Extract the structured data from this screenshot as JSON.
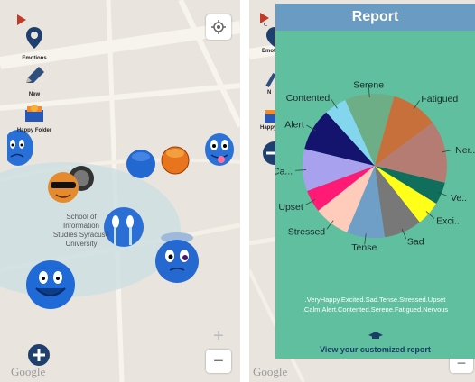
{
  "left_screen": {
    "toolbar": {
      "emotions_label": "Emotions",
      "new_label": "New",
      "happy_folder_label": "Happy Folder"
    },
    "place_label": "School of Information Studies Syracuse University",
    "place_lines": [
      "School of",
      "Information",
      "Studies Syracuse",
      "University"
    ],
    "zoom_in_label": "+",
    "zoom_out_label": "−",
    "google_label": "Google"
  },
  "right_screen": {
    "behind": {
      "emotions_label": "Emoti",
      "new_label": "N",
      "happy_label": "Happy",
      "google_label": "Google",
      "top_label": "L"
    },
    "report": {
      "title": "Report",
      "legend_line1": ".VeryHappy.Excited.Sad.Tense.Stressed.Upset",
      "legend_line2": ".Calm.Alert.Contented.Serene.Fatigued.Nervous",
      "view_report_label": "View your customized report"
    }
  },
  "colors": {
    "report_header": "#6a9bc3",
    "report_panel": "#5fbf9f",
    "map_background": "#e9e5de",
    "campus_area": "#cfdfe2"
  },
  "chart_data": {
    "type": "pie",
    "title": "",
    "categories": [
      "Fatigued",
      "Ner..",
      "Ve..",
      "Exci..",
      "Sad",
      "Tense",
      "Stressed",
      "Upset",
      "Ca...",
      "Alert",
      "Contented",
      "Serene"
    ],
    "full_names": [
      "Fatigued",
      "Nervous",
      "VeryHappy",
      "Excited",
      "Sad",
      "Tense",
      "Stressed",
      "Upset",
      "Calm",
      "Alert",
      "Contented",
      "Serene"
    ],
    "values": [
      10.5,
      14.0,
      5.0,
      5.5,
      8.5,
      8.5,
      8.0,
      5.0,
      9.5,
      9.5,
      5.0,
      11.0
    ],
    "colors": [
      "#c8703b",
      "#b57c74",
      "#0f6e5c",
      "#ffff1a",
      "#787878",
      "#6f9ec6",
      "#ffccbb",
      "#ff1a75",
      "#a8a2ee",
      "#14136e",
      "#84d6ee",
      "#6eae86"
    ],
    "legend": "bottom"
  }
}
